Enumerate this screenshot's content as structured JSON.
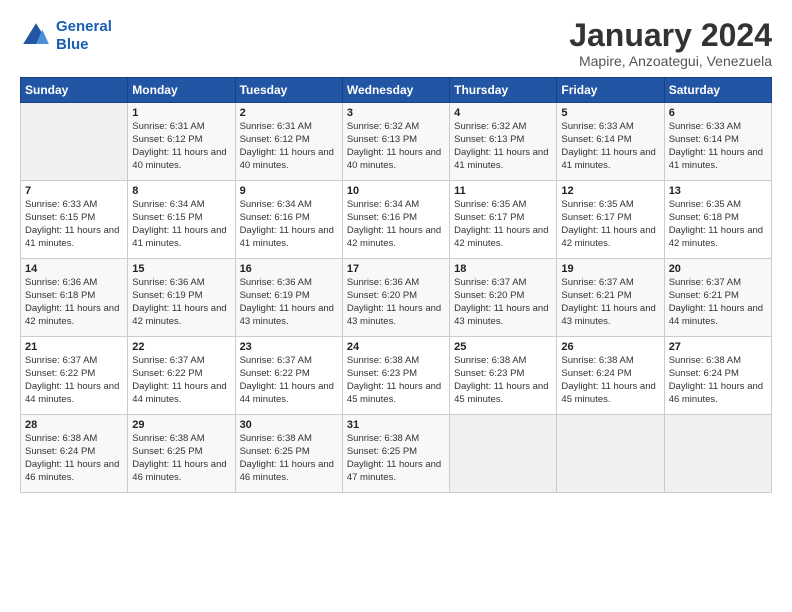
{
  "header": {
    "logo_line1": "General",
    "logo_line2": "Blue",
    "title": "January 2024",
    "location": "Mapire, Anzoategui, Venezuela"
  },
  "weekdays": [
    "Sunday",
    "Monday",
    "Tuesday",
    "Wednesday",
    "Thursday",
    "Friday",
    "Saturday"
  ],
  "weeks": [
    [
      {
        "num": "",
        "sunrise": "",
        "sunset": "",
        "daylight": ""
      },
      {
        "num": "1",
        "sunrise": "Sunrise: 6:31 AM",
        "sunset": "Sunset: 6:12 PM",
        "daylight": "Daylight: 11 hours and 40 minutes."
      },
      {
        "num": "2",
        "sunrise": "Sunrise: 6:31 AM",
        "sunset": "Sunset: 6:12 PM",
        "daylight": "Daylight: 11 hours and 40 minutes."
      },
      {
        "num": "3",
        "sunrise": "Sunrise: 6:32 AM",
        "sunset": "Sunset: 6:13 PM",
        "daylight": "Daylight: 11 hours and 40 minutes."
      },
      {
        "num": "4",
        "sunrise": "Sunrise: 6:32 AM",
        "sunset": "Sunset: 6:13 PM",
        "daylight": "Daylight: 11 hours and 41 minutes."
      },
      {
        "num": "5",
        "sunrise": "Sunrise: 6:33 AM",
        "sunset": "Sunset: 6:14 PM",
        "daylight": "Daylight: 11 hours and 41 minutes."
      },
      {
        "num": "6",
        "sunrise": "Sunrise: 6:33 AM",
        "sunset": "Sunset: 6:14 PM",
        "daylight": "Daylight: 11 hours and 41 minutes."
      }
    ],
    [
      {
        "num": "7",
        "sunrise": "Sunrise: 6:33 AM",
        "sunset": "Sunset: 6:15 PM",
        "daylight": "Daylight: 11 hours and 41 minutes."
      },
      {
        "num": "8",
        "sunrise": "Sunrise: 6:34 AM",
        "sunset": "Sunset: 6:15 PM",
        "daylight": "Daylight: 11 hours and 41 minutes."
      },
      {
        "num": "9",
        "sunrise": "Sunrise: 6:34 AM",
        "sunset": "Sunset: 6:16 PM",
        "daylight": "Daylight: 11 hours and 41 minutes."
      },
      {
        "num": "10",
        "sunrise": "Sunrise: 6:34 AM",
        "sunset": "Sunset: 6:16 PM",
        "daylight": "Daylight: 11 hours and 42 minutes."
      },
      {
        "num": "11",
        "sunrise": "Sunrise: 6:35 AM",
        "sunset": "Sunset: 6:17 PM",
        "daylight": "Daylight: 11 hours and 42 minutes."
      },
      {
        "num": "12",
        "sunrise": "Sunrise: 6:35 AM",
        "sunset": "Sunset: 6:17 PM",
        "daylight": "Daylight: 11 hours and 42 minutes."
      },
      {
        "num": "13",
        "sunrise": "Sunrise: 6:35 AM",
        "sunset": "Sunset: 6:18 PM",
        "daylight": "Daylight: 11 hours and 42 minutes."
      }
    ],
    [
      {
        "num": "14",
        "sunrise": "Sunrise: 6:36 AM",
        "sunset": "Sunset: 6:18 PM",
        "daylight": "Daylight: 11 hours and 42 minutes."
      },
      {
        "num": "15",
        "sunrise": "Sunrise: 6:36 AM",
        "sunset": "Sunset: 6:19 PM",
        "daylight": "Daylight: 11 hours and 42 minutes."
      },
      {
        "num": "16",
        "sunrise": "Sunrise: 6:36 AM",
        "sunset": "Sunset: 6:19 PM",
        "daylight": "Daylight: 11 hours and 43 minutes."
      },
      {
        "num": "17",
        "sunrise": "Sunrise: 6:36 AM",
        "sunset": "Sunset: 6:20 PM",
        "daylight": "Daylight: 11 hours and 43 minutes."
      },
      {
        "num": "18",
        "sunrise": "Sunrise: 6:37 AM",
        "sunset": "Sunset: 6:20 PM",
        "daylight": "Daylight: 11 hours and 43 minutes."
      },
      {
        "num": "19",
        "sunrise": "Sunrise: 6:37 AM",
        "sunset": "Sunset: 6:21 PM",
        "daylight": "Daylight: 11 hours and 43 minutes."
      },
      {
        "num": "20",
        "sunrise": "Sunrise: 6:37 AM",
        "sunset": "Sunset: 6:21 PM",
        "daylight": "Daylight: 11 hours and 44 minutes."
      }
    ],
    [
      {
        "num": "21",
        "sunrise": "Sunrise: 6:37 AM",
        "sunset": "Sunset: 6:22 PM",
        "daylight": "Daylight: 11 hours and 44 minutes."
      },
      {
        "num": "22",
        "sunrise": "Sunrise: 6:37 AM",
        "sunset": "Sunset: 6:22 PM",
        "daylight": "Daylight: 11 hours and 44 minutes."
      },
      {
        "num": "23",
        "sunrise": "Sunrise: 6:37 AM",
        "sunset": "Sunset: 6:22 PM",
        "daylight": "Daylight: 11 hours and 44 minutes."
      },
      {
        "num": "24",
        "sunrise": "Sunrise: 6:38 AM",
        "sunset": "Sunset: 6:23 PM",
        "daylight": "Daylight: 11 hours and 45 minutes."
      },
      {
        "num": "25",
        "sunrise": "Sunrise: 6:38 AM",
        "sunset": "Sunset: 6:23 PM",
        "daylight": "Daylight: 11 hours and 45 minutes."
      },
      {
        "num": "26",
        "sunrise": "Sunrise: 6:38 AM",
        "sunset": "Sunset: 6:24 PM",
        "daylight": "Daylight: 11 hours and 45 minutes."
      },
      {
        "num": "27",
        "sunrise": "Sunrise: 6:38 AM",
        "sunset": "Sunset: 6:24 PM",
        "daylight": "Daylight: 11 hours and 46 minutes."
      }
    ],
    [
      {
        "num": "28",
        "sunrise": "Sunrise: 6:38 AM",
        "sunset": "Sunset: 6:24 PM",
        "daylight": "Daylight: 11 hours and 46 minutes."
      },
      {
        "num": "29",
        "sunrise": "Sunrise: 6:38 AM",
        "sunset": "Sunset: 6:25 PM",
        "daylight": "Daylight: 11 hours and 46 minutes."
      },
      {
        "num": "30",
        "sunrise": "Sunrise: 6:38 AM",
        "sunset": "Sunset: 6:25 PM",
        "daylight": "Daylight: 11 hours and 46 minutes."
      },
      {
        "num": "31",
        "sunrise": "Sunrise: 6:38 AM",
        "sunset": "Sunset: 6:25 PM",
        "daylight": "Daylight: 11 hours and 47 minutes."
      },
      {
        "num": "",
        "sunrise": "",
        "sunset": "",
        "daylight": ""
      },
      {
        "num": "",
        "sunrise": "",
        "sunset": "",
        "daylight": ""
      },
      {
        "num": "",
        "sunrise": "",
        "sunset": "",
        "daylight": ""
      }
    ]
  ]
}
